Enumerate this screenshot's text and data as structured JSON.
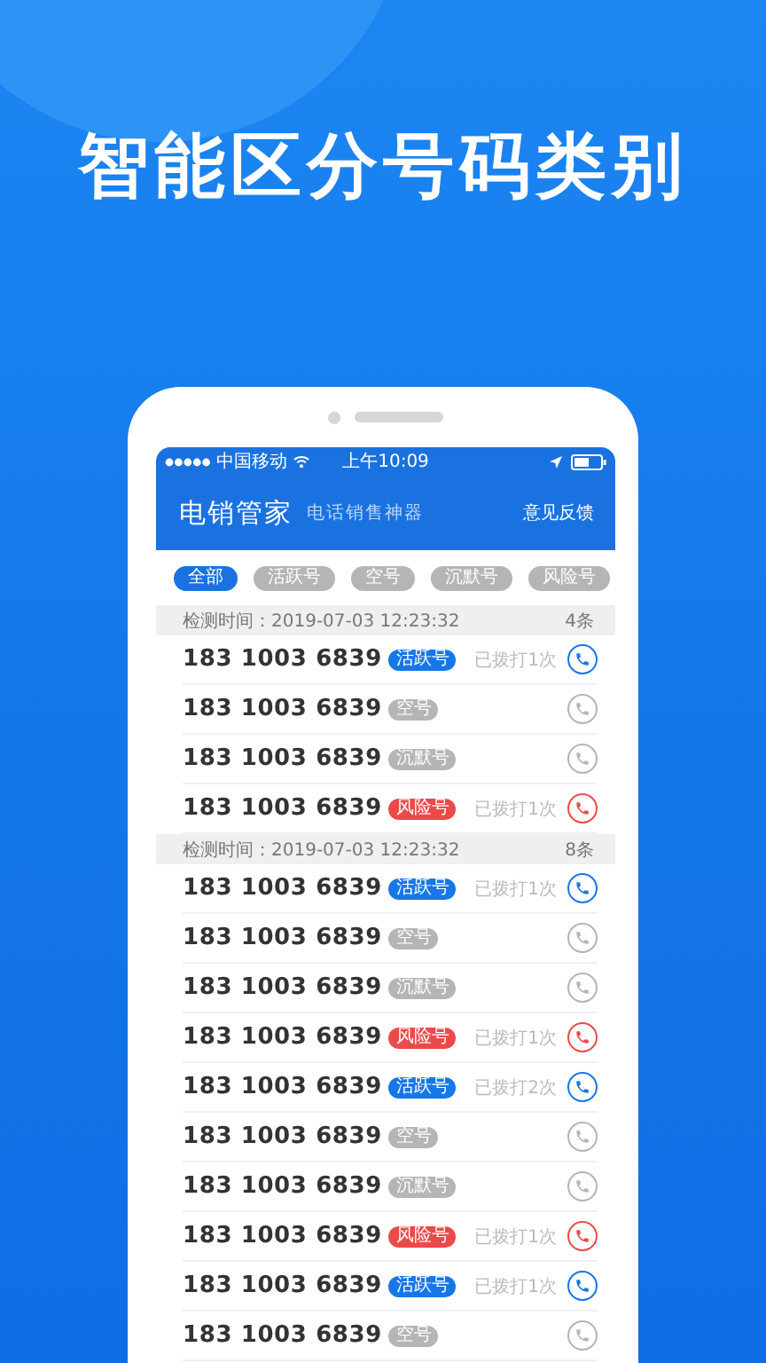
{
  "headline": "智能区分号码类别",
  "status_bar": {
    "carrier": "中国移动",
    "time": "上午10:09"
  },
  "app_bar": {
    "title": "电销管家",
    "subtitle": "电话销售神器",
    "action": "意见反馈"
  },
  "filters": [
    {
      "label": "全部",
      "selected": true
    },
    {
      "label": "活跃号",
      "selected": false
    },
    {
      "label": "空号",
      "selected": false
    },
    {
      "label": "沉默号",
      "selected": false
    },
    {
      "label": "风险号",
      "selected": false
    }
  ],
  "groups": [
    {
      "time": "检测时间：2019-07-03 12:23:32",
      "count": "4条",
      "rows": [
        {
          "number": "183 1003 6839",
          "kind": "active",
          "tag": "活跃号",
          "note": "已拨打1次"
        },
        {
          "number": "183 1003 6839",
          "kind": "empty",
          "tag": "空号"
        },
        {
          "number": "183 1003 6839",
          "kind": "silent",
          "tag": "沉默号"
        },
        {
          "number": "183 1003 6839",
          "kind": "risk",
          "tag": "风险号",
          "note": "已拨打1次"
        }
      ]
    },
    {
      "time": "检测时间：2019-07-03 12:23:32",
      "count": "8条",
      "rows": [
        {
          "number": "183 1003 6839",
          "kind": "active",
          "tag": "活跃号",
          "note": "已拨打1次"
        },
        {
          "number": "183 1003 6839",
          "kind": "empty",
          "tag": "空号"
        },
        {
          "number": "183 1003 6839",
          "kind": "silent",
          "tag": "沉默号"
        },
        {
          "number": "183 1003 6839",
          "kind": "risk",
          "tag": "风险号",
          "note": "已拨打1次"
        },
        {
          "number": "183 1003 6839",
          "kind": "active",
          "tag": "活跃号",
          "note": "已拨打2次"
        },
        {
          "number": "183 1003 6839",
          "kind": "empty",
          "tag": "空号"
        },
        {
          "number": "183 1003 6839",
          "kind": "silent",
          "tag": "沉默号"
        },
        {
          "number": "183 1003 6839",
          "kind": "risk",
          "tag": "风险号",
          "note": "已拨打1次"
        },
        {
          "number": "183 1003 6839",
          "kind": "active",
          "tag": "活跃号",
          "note": "已拨打1次"
        },
        {
          "number": "183 1003 6839",
          "kind": "empty",
          "tag": "空号"
        }
      ]
    }
  ]
}
